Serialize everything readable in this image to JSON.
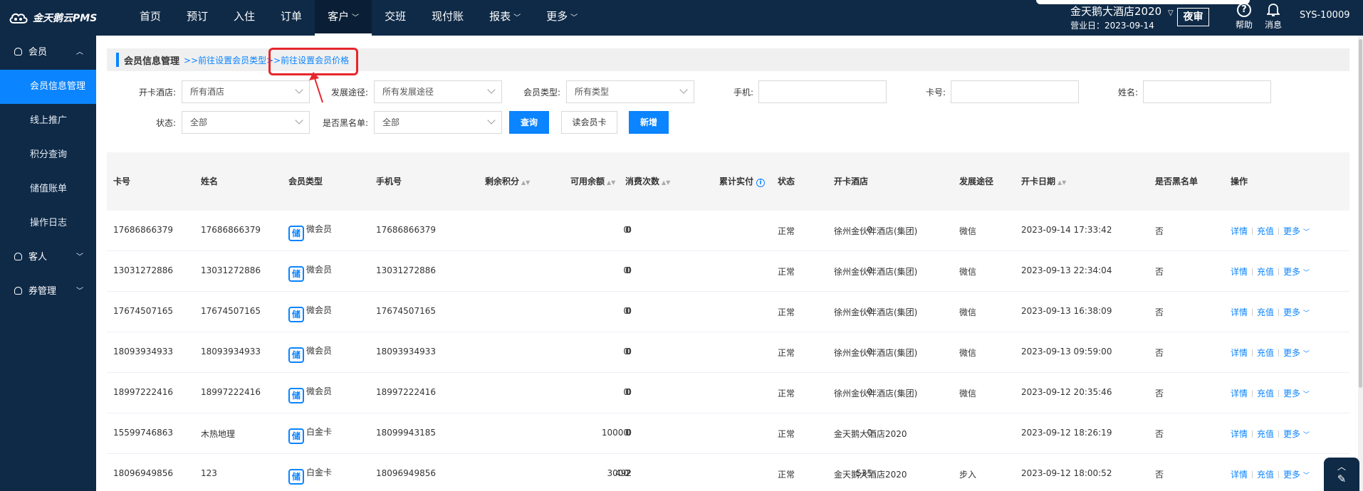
{
  "header": {
    "logo_text": "金天鹅云PMS",
    "nav": [
      {
        "label": "首页",
        "caret": false
      },
      {
        "label": "预订",
        "caret": false
      },
      {
        "label": "入住",
        "caret": false
      },
      {
        "label": "订单",
        "caret": false
      },
      {
        "label": "客户",
        "caret": true,
        "active": true
      },
      {
        "label": "交班",
        "caret": false
      },
      {
        "label": "现付账",
        "caret": false
      },
      {
        "label": "报表",
        "caret": true
      },
      {
        "label": "更多",
        "caret": true
      }
    ],
    "hotel_name": "金天鹅大酒店2020",
    "business_day": "营业日：2023-09-14",
    "night_audit": "夜审",
    "help": "帮助",
    "messages": "消息",
    "user": "SYS-10009"
  },
  "sidebar": {
    "groups": [
      {
        "label": "会员",
        "expanded": true,
        "items": [
          "会员信息管理",
          "线上推广",
          "积分查询",
          "储值账单",
          "操作日志"
        ]
      },
      {
        "label": "客人",
        "expanded": false
      },
      {
        "label": "券管理",
        "expanded": false
      }
    ]
  },
  "breadcrumb": {
    "title": "会员信息管理",
    "link1": ">>前往设置会员类型",
    "link2": ">>前往设置会员价格"
  },
  "filters": {
    "hotel_label": "开卡酒店:",
    "hotel_value": "所有酒店",
    "channel_label": "发展途径:",
    "channel_value": "所有发展途径",
    "type_label": "会员类型:",
    "type_value": "所有类型",
    "phone_label": "手机:",
    "card_label": "卡号:",
    "name_label": "姓名:",
    "status_label": "状态:",
    "status_value": "全部",
    "blacklist_label": "是否黑名单:",
    "blacklist_value": "全部",
    "query_btn": "查询",
    "read_card_btn": "读会员卡",
    "add_btn": "新增"
  },
  "table": {
    "headers": {
      "card": "卡号",
      "name": "姓名",
      "type": "会员类型",
      "phone": "手机号",
      "points": "剩余积分",
      "balance": "可用余额",
      "count": "消费次数",
      "paid": "累计实付",
      "status": "状态",
      "hotel": "开卡酒店",
      "channel": "发展途径",
      "date": "开卡日期",
      "black": "是否黑名单",
      "ops": "操作"
    },
    "badge": "储",
    "actions": {
      "detail": "详情",
      "recharge": "充值",
      "more": "更多"
    },
    "rows": [
      {
        "card": "17686866379",
        "name": "17686866379",
        "type": "微会员",
        "phone": "17686866379",
        "points": "0",
        "balance": "0",
        "count": "0",
        "paid": "0",
        "status": "正常",
        "hotel": "徐州金伙伴酒店(集团)",
        "channel": "微信",
        "date": "2023-09-14 17:33:42",
        "black": "否"
      },
      {
        "card": "13031272886",
        "name": "13031272886",
        "type": "微会员",
        "phone": "13031272886",
        "points": "0",
        "balance": "0",
        "count": "0",
        "paid": "0",
        "status": "正常",
        "hotel": "徐州金伙伴酒店(集团)",
        "channel": "微信",
        "date": "2023-09-13 22:34:04",
        "black": "否"
      },
      {
        "card": "17674507165",
        "name": "17674507165",
        "type": "微会员",
        "phone": "17674507165",
        "points": "0",
        "balance": "0",
        "count": "0",
        "paid": "0",
        "status": "正常",
        "hotel": "徐州金伙伴酒店(集团)",
        "channel": "微信",
        "date": "2023-09-13 16:38:09",
        "black": "否"
      },
      {
        "card": "18093934933",
        "name": "18093934933",
        "type": "微会员",
        "phone": "18093934933",
        "points": "0",
        "balance": "0",
        "count": "0",
        "paid": "0",
        "status": "正常",
        "hotel": "徐州金伙伴酒店(集团)",
        "channel": "微信",
        "date": "2023-09-13 09:59:00",
        "black": "否"
      },
      {
        "card": "18997222416",
        "name": "18997222416",
        "type": "微会员",
        "phone": "18997222416",
        "points": "0",
        "balance": "0",
        "count": "0",
        "paid": "0",
        "status": "正常",
        "hotel": "徐州金伙伴酒店(集团)",
        "channel": "微信",
        "date": "2023-09-12 20:35:46",
        "black": "否"
      },
      {
        "card": "15599746863",
        "name": "木热地理",
        "type": "白金卡",
        "phone": "18099943185",
        "points": "0",
        "balance": "10000",
        "count": "0",
        "paid": "0",
        "status": "正常",
        "hotel": "金天鹅大酒店2020",
        "channel": "",
        "date": "2023-09-12 18:26:19",
        "black": "否"
      },
      {
        "card": "18096949856",
        "name": "123",
        "type": "白金卡",
        "phone": "18096949856",
        "points": "492",
        "balance": "3000",
        "count": "2",
        "paid": "535",
        "status": "正常",
        "hotel": "金天鹅大酒店2020",
        "channel": "步入",
        "date": "2023-09-12 18:00:52",
        "black": "否"
      }
    ]
  }
}
